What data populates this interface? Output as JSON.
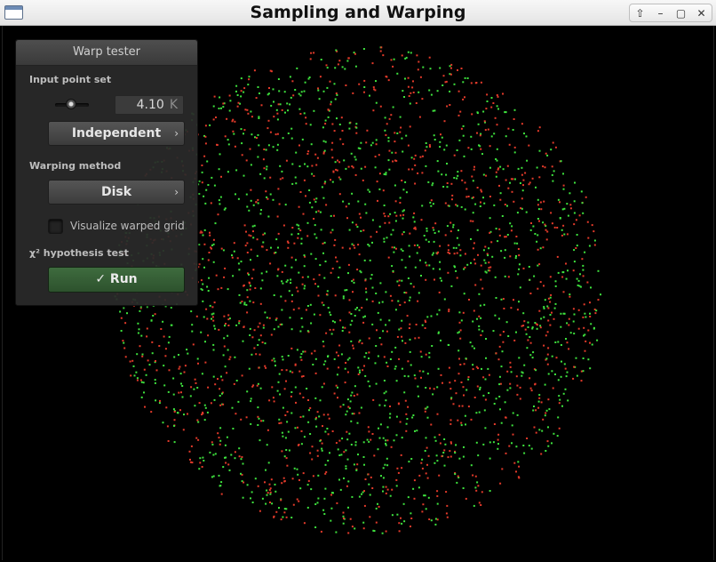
{
  "window": {
    "title": "Sampling and Warping",
    "controls": {
      "restore": "⇧",
      "minimize": "–",
      "maximize": "▢",
      "close": "✕"
    }
  },
  "panel": {
    "title": "Warp tester",
    "input_point_set_label": "Input point set",
    "point_count": "4.10",
    "point_count_unit": "K",
    "point_set_value": "Independent",
    "warping_method_label": "Warping method",
    "warping_method_value": "Disk",
    "visualize_grid_label": "Visualize warped grid",
    "visualize_grid_checked": false,
    "hypothesis_label": "χ² hypothesis test",
    "run_label": "✓ Run"
  },
  "icons": {
    "chevron": "chevron-right-icon",
    "check": "check-icon"
  },
  "colors": {
    "background": "#000000",
    "point_green": "#3ee23e",
    "point_red": "#e23a2a",
    "run_button": "#3a653a"
  }
}
